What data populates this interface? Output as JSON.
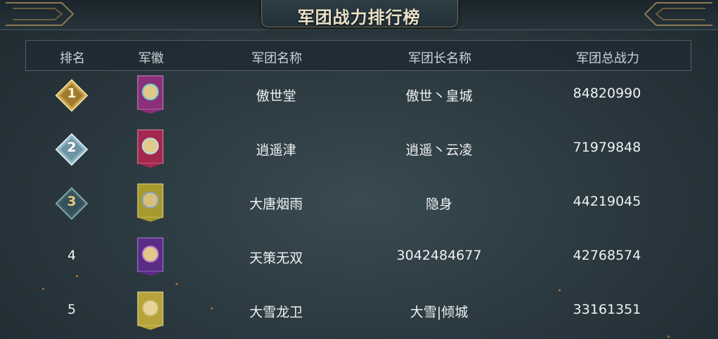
{
  "title": "军团战力排行榜",
  "headers": {
    "rank": "排名",
    "emblem": "军徽",
    "legion_name": "军团名称",
    "leader_name": "军团长名称",
    "power": "军团总战力"
  },
  "rows": [
    {
      "rank": "1",
      "emblem_color": "#8a2f7a",
      "legion_name": "傲世堂",
      "leader_name": "傲世丶皇城",
      "power": "84820990"
    },
    {
      "rank": "2",
      "emblem_color": "#a3284f",
      "legion_name": "逍遥津",
      "leader_name": "逍遥丶云凌",
      "power": "71979848"
    },
    {
      "rank": "3",
      "emblem_color": "#a69a2c",
      "legion_name": "大唐烟雨",
      "leader_name": "隐身",
      "power": "44219045"
    },
    {
      "rank": "4",
      "emblem_color": "#5b2c86",
      "legion_name": "天策无双",
      "leader_name": "3042484677",
      "power": "42768574"
    },
    {
      "rank": "5",
      "emblem_color": "#b6a33a",
      "legion_name": "大雪龙卫",
      "leader_name": "大雪|倾城",
      "power": "33161351"
    }
  ],
  "colors": {
    "gold": "#c9a14a",
    "silver": "#8fb3c4",
    "bronze": "#7fa5b0"
  }
}
